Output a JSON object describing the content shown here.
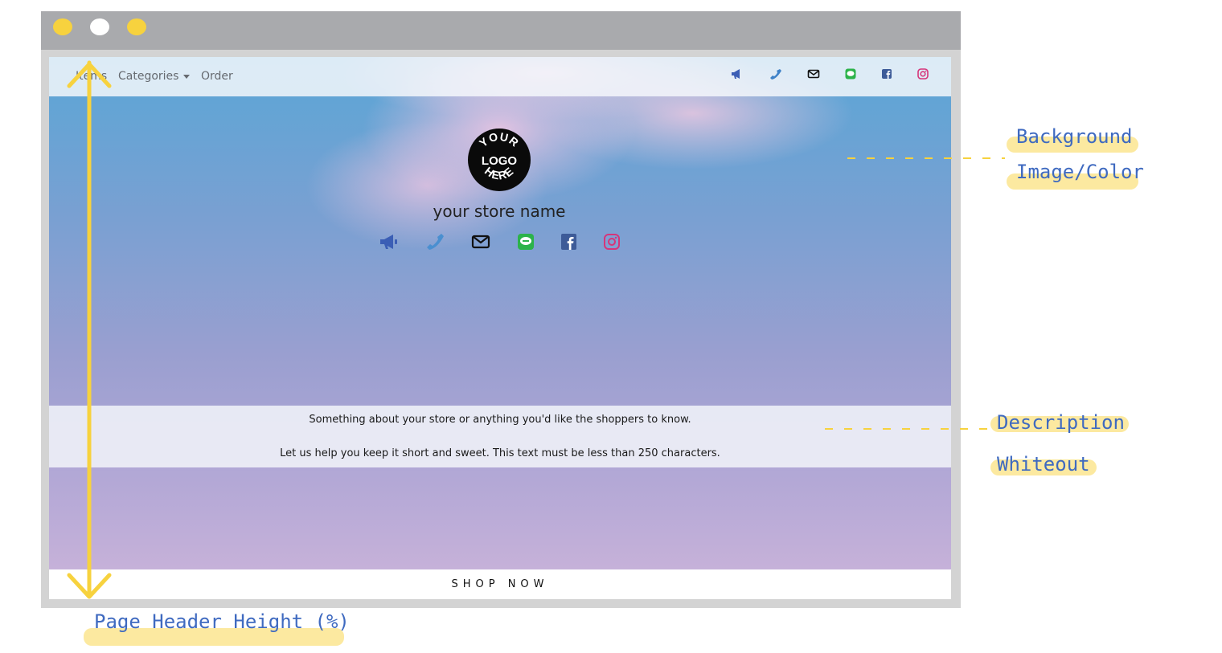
{
  "browser": {
    "window_dots": [
      "yellow",
      "white",
      "yellow"
    ]
  },
  "nav": {
    "home_label": "Items",
    "categories_label": "Categories",
    "order_label": "Order",
    "social_icons": [
      "megaphone-icon",
      "phone-icon",
      "mail-icon",
      "line-icon",
      "facebook-icon",
      "instagram-icon"
    ]
  },
  "hero": {
    "logo_lines": [
      "YOUR",
      "LOGO",
      "HERE"
    ],
    "store_name": "your store name"
  },
  "description": {
    "line1": "Something about your store or anything you'd like the shoppers to know.",
    "line2": "Let us help you keep it short and sweet. This text must be less than 250 characters."
  },
  "cta": {
    "label": "SHOP NOW"
  },
  "annotations": {
    "background": "Background Image/Color",
    "description": "Description Whiteout",
    "height": "Page Header Height (%)"
  },
  "colors": {
    "annotation_yellow": "#f7d23e",
    "annotation_blue": "#3f6ac0",
    "highlight": "#fce9a0",
    "megaphone": "#3b5eb5",
    "phone": "#3f82c8",
    "line": "#2cb34a",
    "facebook": "#3d5b98",
    "instagram": "#d6357a"
  }
}
